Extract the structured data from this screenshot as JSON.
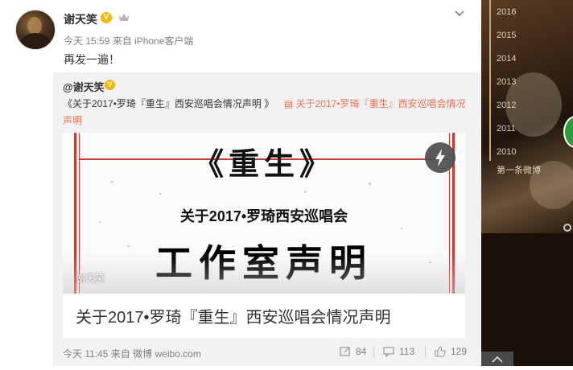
{
  "post": {
    "username": "谢天笑",
    "verified_badge": "V",
    "meta": "今天 15:59 来自 iPhone客户端",
    "text": "再发一遍！"
  },
  "repost": {
    "original_user": "@谢天笑",
    "verified_badge": "V",
    "text_prefix": "《关于2017•罗琦『重生』西安巡唱会情况声明 》",
    "link_text": "关于2017•罗琦『重生』西安巡唱会情况声明",
    "card": {
      "image_title": "《重生》",
      "image_subtitle": "关于2017•罗琦西安巡唱会",
      "image_big": "工作室声明",
      "watermark": "谢天笑",
      "caption": "关于2017•罗琦『重生』西安巡唱会情况声明"
    },
    "footer": {
      "time": "今天 11:45 来自 微博 weibo.com",
      "reposts": "84",
      "comments": "113",
      "likes": "129"
    }
  },
  "timeline": {
    "years": [
      "2016",
      "2015",
      "2014",
      "2013",
      "2012",
      "2011",
      "2010"
    ],
    "first_post": "第一条微博"
  },
  "colors": {
    "accent": "#eb7350",
    "verified": "#f5b900",
    "frame_red": "#c63a34"
  }
}
